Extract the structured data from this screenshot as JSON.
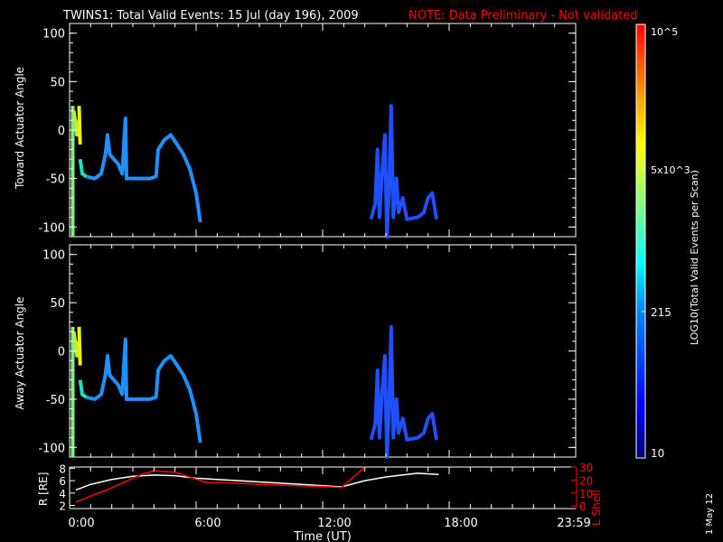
{
  "title": {
    "main": "TWINS1: Total Valid Events: 15 Jul (day 196), 2009",
    "note": "NOTE: Data Preliminary - Not validated"
  },
  "colors": {
    "axis": "#ffffff",
    "note": "#ff0000",
    "lshell": "#ff0000",
    "radius": "#ffffff"
  },
  "footer": {
    "date_stamp": "1 May 12"
  },
  "chart_data": [
    {
      "type": "heatmap",
      "panel": "toward",
      "ylabel": "Toward Actuator Angle",
      "ylim": [
        -110,
        110
      ],
      "yticks": [
        "100",
        "50",
        "0",
        "-50",
        "-100"
      ],
      "ytick_values": [
        100,
        50,
        0,
        -50,
        -100
      ],
      "xlim_hours": [
        0,
        24
      ],
      "segments": [
        {
          "color": "#7cf07c",
          "points": [
            [
              0.15,
              -110
            ],
            [
              0.15,
              25
            ]
          ]
        },
        {
          "color": "#b8f040",
          "points": [
            [
              0.2,
              20
            ],
            [
              0.3,
              5
            ],
            [
              0.35,
              -5
            ],
            [
              0.4,
              10
            ]
          ]
        },
        {
          "color": "#f0f000",
          "points": [
            [
              0.45,
              25
            ],
            [
              0.5,
              -15
            ]
          ]
        },
        {
          "color": "#20e0c0",
          "points": [
            [
              0.5,
              -30
            ],
            [
              0.6,
              -45
            ],
            [
              0.8,
              -48
            ]
          ]
        },
        {
          "color": "#1e90ff",
          "points": [
            [
              0.8,
              -48
            ],
            [
              1.2,
              -50
            ],
            [
              1.5,
              -45
            ],
            [
              1.7,
              -25
            ],
            [
              1.8,
              -5
            ],
            [
              1.9,
              -25
            ],
            [
              2.1,
              -30
            ],
            [
              2.3,
              -35
            ],
            [
              2.5,
              -45
            ],
            [
              2.6,
              -5
            ],
            [
              2.65,
              12
            ],
            [
              2.7,
              -50
            ],
            [
              3.2,
              -50
            ],
            [
              3.8,
              -50
            ],
            [
              4.1,
              -48
            ],
            [
              4.2,
              -20
            ],
            [
              4.5,
              -10
            ],
            [
              4.8,
              -5
            ],
            [
              5.1,
              -15
            ],
            [
              5.4,
              -25
            ],
            [
              5.7,
              -40
            ],
            [
              6.0,
              -65
            ],
            [
              6.2,
              -95
            ]
          ]
        },
        {
          "color": "#1e50ff",
          "points": [
            [
              14.3,
              -92
            ],
            [
              14.5,
              -75
            ],
            [
              14.6,
              -20
            ],
            [
              14.7,
              -90
            ],
            [
              14.8,
              -50
            ],
            [
              14.95,
              -5
            ],
            [
              15.05,
              -110
            ],
            [
              15.15,
              -60
            ],
            [
              15.25,
              25
            ],
            [
              15.35,
              -90
            ],
            [
              15.5,
              -50
            ],
            [
              15.6,
              -85
            ],
            [
              15.8,
              -70
            ],
            [
              16.0,
              -92
            ],
            [
              16.5,
              -90
            ],
            [
              16.8,
              -85
            ],
            [
              17.0,
              -70
            ],
            [
              17.2,
              -65
            ],
            [
              17.4,
              -92
            ]
          ]
        }
      ]
    },
    {
      "type": "heatmap",
      "panel": "away",
      "ylabel": "Away Actuator Angle",
      "ylim": [
        -110,
        110
      ],
      "yticks": [
        "100",
        "50",
        "0",
        "-50",
        "-100"
      ],
      "ytick_values": [
        100,
        50,
        0,
        -50,
        -100
      ],
      "xlim_hours": [
        0,
        24
      ],
      "segments": [
        {
          "color": "#7cf07c",
          "points": [
            [
              0.15,
              -110
            ],
            [
              0.15,
              25
            ]
          ]
        },
        {
          "color": "#b8f040",
          "points": [
            [
              0.2,
              20
            ],
            [
              0.3,
              5
            ],
            [
              0.35,
              -5
            ],
            [
              0.4,
              10
            ]
          ]
        },
        {
          "color": "#f0f000",
          "points": [
            [
              0.45,
              25
            ],
            [
              0.5,
              -15
            ]
          ]
        },
        {
          "color": "#20e0c0",
          "points": [
            [
              0.5,
              -30
            ],
            [
              0.6,
              -45
            ],
            [
              0.8,
              -48
            ]
          ]
        },
        {
          "color": "#1e90ff",
          "points": [
            [
              0.8,
              -48
            ],
            [
              1.2,
              -50
            ],
            [
              1.5,
              -45
            ],
            [
              1.7,
              -25
            ],
            [
              1.8,
              -5
            ],
            [
              1.9,
              -25
            ],
            [
              2.1,
              -30
            ],
            [
              2.3,
              -35
            ],
            [
              2.5,
              -45
            ],
            [
              2.6,
              -5
            ],
            [
              2.65,
              12
            ],
            [
              2.7,
              -50
            ],
            [
              3.2,
              -50
            ],
            [
              3.8,
              -50
            ],
            [
              4.1,
              -48
            ],
            [
              4.2,
              -20
            ],
            [
              4.5,
              -10
            ],
            [
              4.8,
              -5
            ],
            [
              5.1,
              -15
            ],
            [
              5.4,
              -25
            ],
            [
              5.7,
              -40
            ],
            [
              6.0,
              -65
            ],
            [
              6.2,
              -95
            ]
          ]
        },
        {
          "color": "#1e50ff",
          "points": [
            [
              14.3,
              -92
            ],
            [
              14.5,
              -75
            ],
            [
              14.6,
              -20
            ],
            [
              14.7,
              -90
            ],
            [
              14.8,
              -50
            ],
            [
              14.95,
              -5
            ],
            [
              15.05,
              -110
            ],
            [
              15.15,
              -60
            ],
            [
              15.25,
              25
            ],
            [
              15.35,
              -90
            ],
            [
              15.5,
              -50
            ],
            [
              15.6,
              -85
            ],
            [
              15.8,
              -70
            ],
            [
              16.0,
              -92
            ],
            [
              16.5,
              -90
            ],
            [
              16.8,
              -85
            ],
            [
              17.0,
              -70
            ],
            [
              17.2,
              -65
            ],
            [
              17.4,
              -92
            ]
          ]
        }
      ]
    },
    {
      "type": "line",
      "panel": "orbit",
      "xlabel": "Time (UT)",
      "xticks": [
        "0:00",
        "6:00",
        "12:00",
        "18:00",
        "23:59"
      ],
      "xtick_hours": [
        0,
        6,
        12,
        18,
        23.98
      ],
      "ylabel_left": "R [RE]",
      "ylabel_right": "L Shell",
      "left_ylim": [
        1.5,
        8.2
      ],
      "left_yticks": [
        "8",
        "6",
        "4",
        "2"
      ],
      "left_ytick_values": [
        8,
        6,
        4,
        2
      ],
      "right_ylim": [
        -2,
        30
      ],
      "right_yticks": [
        "30",
        "20",
        "10",
        "0"
      ],
      "right_ytick_values": [
        30,
        20,
        10,
        0
      ],
      "series": [
        {
          "name": "R",
          "axis": "left",
          "points": [
            [
              0.3,
              4.5
            ],
            [
              1,
              5.4
            ],
            [
              2,
              6.2
            ],
            [
              3,
              6.7
            ],
            [
              4,
              6.9
            ],
            [
              5,
              6.8
            ],
            [
              6,
              6.4
            ],
            [
              7,
              6.2
            ],
            [
              9,
              5.8
            ],
            [
              11,
              5.4
            ],
            [
              12.9,
              5.0
            ],
            [
              14,
              6.0
            ],
            [
              15,
              6.6
            ],
            [
              16,
              7.0
            ],
            [
              16.5,
              7.2
            ],
            [
              17.5,
              7.0
            ]
          ]
        },
        {
          "name": "L Shell",
          "axis": "right",
          "points": [
            [
              0.3,
              3
            ],
            [
              2,
              14
            ],
            [
              3.5,
              25
            ],
            [
              4,
              27
            ],
            [
              5,
              26
            ],
            [
              6.5,
              18
            ],
            [
              8,
              17.5
            ],
            [
              10,
              16
            ],
            [
              12,
              15
            ],
            [
              12.9,
              14.2
            ],
            [
              14,
              30
            ]
          ]
        }
      ]
    },
    {
      "type": "colorbar",
      "label": "LOG10(Total Valid Events per Scan)",
      "tick_labels": [
        "10^5",
        "5x10^3",
        "215",
        "10"
      ],
      "tick_values": [
        100000,
        5000,
        215,
        10
      ]
    }
  ]
}
